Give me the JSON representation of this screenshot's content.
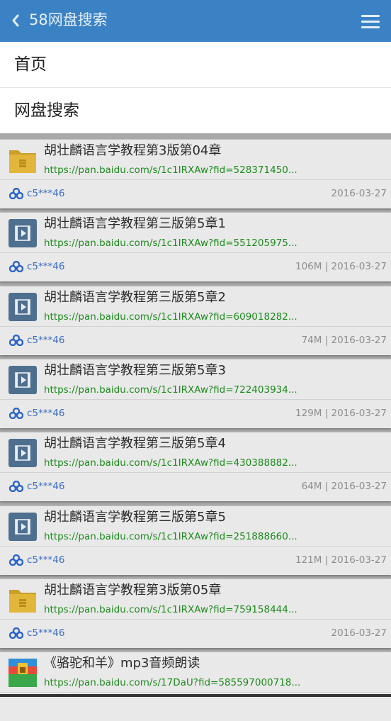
{
  "header": {
    "back_icon": "chevron-left-icon",
    "title": "58网盘搜索",
    "menu_icon": "hamburger-menu-icon",
    "bg_color": "#3a82c4"
  },
  "nav": [
    {
      "label": "首页"
    },
    {
      "label": "网盘搜索"
    }
  ],
  "results": [
    {
      "icon": "folder",
      "title": "胡壮麟语言学教程第3版第04章",
      "url": "https://pan.baidu.com/s/1c1IRXAw?fid=528371450...",
      "owner": "c5***46",
      "meta": "2016-03-27"
    },
    {
      "icon": "video",
      "title": "胡壮麟语言学教程第三版第5章1",
      "url": "https://pan.baidu.com/s/1c1IRXAw?fid=551205975...",
      "owner": "c5***46",
      "meta": "106M | 2016-03-27"
    },
    {
      "icon": "video",
      "title": "胡壮麟语言学教程第三版第5章2",
      "url": "https://pan.baidu.com/s/1c1IRXAw?fid=609018282...",
      "owner": "c5***46",
      "meta": "74M | 2016-03-27"
    },
    {
      "icon": "video",
      "title": "胡壮麟语言学教程第三版第5章3",
      "url": "https://pan.baidu.com/s/1c1IRXAw?fid=722403934...",
      "owner": "c5***46",
      "meta": "129M | 2016-03-27"
    },
    {
      "icon": "video",
      "title": "胡壮麟语言学教程第三版第5章4",
      "url": "https://pan.baidu.com/s/1c1IRXAw?fid=430388882...",
      "owner": "c5***46",
      "meta": "64M | 2016-03-27"
    },
    {
      "icon": "video",
      "title": "胡壮麟语言学教程第三版第5章5",
      "url": "https://pan.baidu.com/s/1c1IRXAw?fid=251888660...",
      "owner": "c5***46",
      "meta": "121M | 2016-03-27"
    },
    {
      "icon": "folder",
      "title": "胡壮麟语言学教程第3版第05章",
      "url": "https://pan.baidu.com/s/1c1IRXAw?fid=759158444...",
      "owner": "c5***46",
      "meta": "2016-03-27"
    },
    {
      "icon": "archive",
      "title": "《骆驼和羊》mp3音频朗读",
      "url": "https://pan.baidu.com/s/17DaU?fid=585597000718...",
      "owner": "",
      "meta": ""
    }
  ],
  "colors": {
    "url": "#1d8a1d",
    "owner": "#3b6cc4",
    "meta": "#8d8d8d"
  }
}
